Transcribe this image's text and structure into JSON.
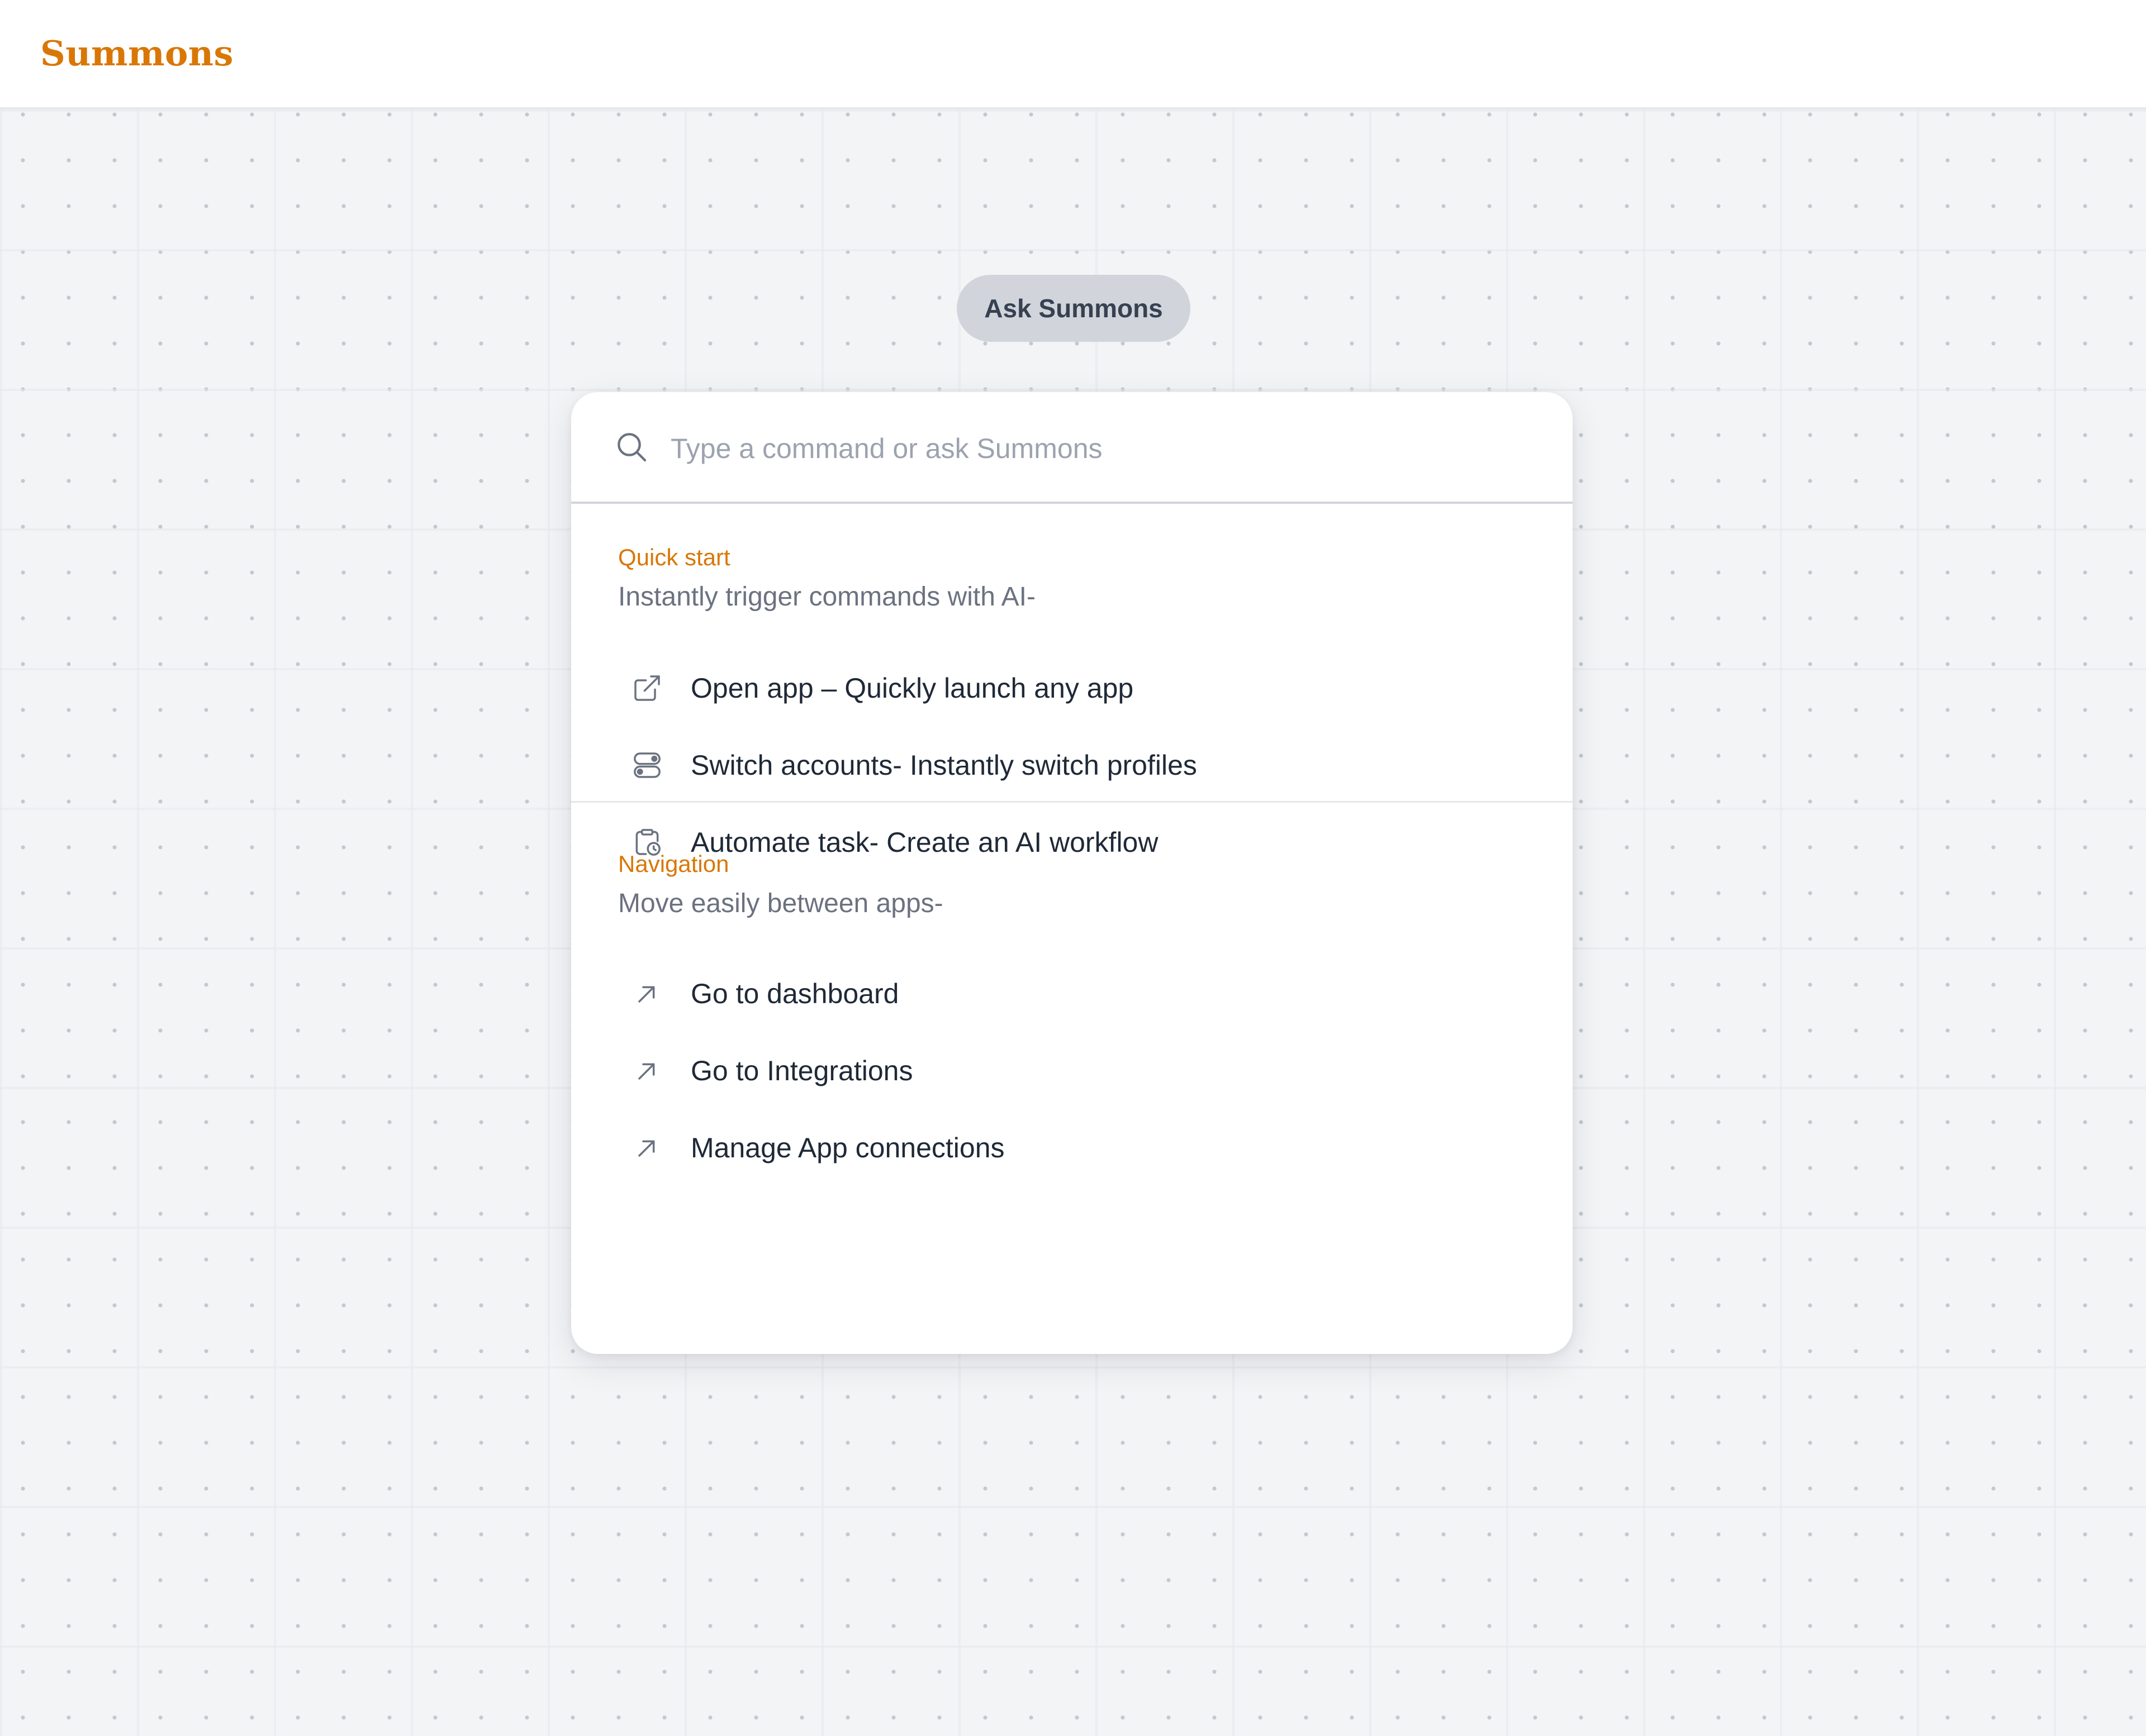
{
  "app": {
    "brand": "Summons"
  },
  "ask_button": {
    "label": "Ask Summons"
  },
  "search": {
    "placeholder": "Type a command or ask Summons",
    "value": "",
    "icon": "search-icon"
  },
  "quick_start": {
    "title": "Quick start",
    "subtitle": "Instantly trigger commands with AI-",
    "items": [
      {
        "label": "Open app – Quickly launch any app",
        "icon": "external-link-icon"
      },
      {
        "label": "Switch accounts- Instantly switch profiles",
        "icon": "toggle-switch-icon"
      },
      {
        "label": "Automate task- Create an AI workflow",
        "icon": "clipboard-clock-icon"
      }
    ]
  },
  "navigation": {
    "title": "Navigation",
    "subtitle": "Move easily between apps-",
    "items": [
      {
        "label": "Go to dashboard",
        "icon": "arrow-up-right-icon"
      },
      {
        "label": "Go to Integrations",
        "icon": "arrow-up-right-icon"
      },
      {
        "label": "Manage App connections",
        "icon": "arrow-up-right-icon"
      }
    ]
  },
  "colors": {
    "accent": "#d97706",
    "background": "#f3f4f6",
    "pill": "#d1d5db",
    "text_primary": "#1f2937",
    "text_muted": "#6b7280"
  }
}
